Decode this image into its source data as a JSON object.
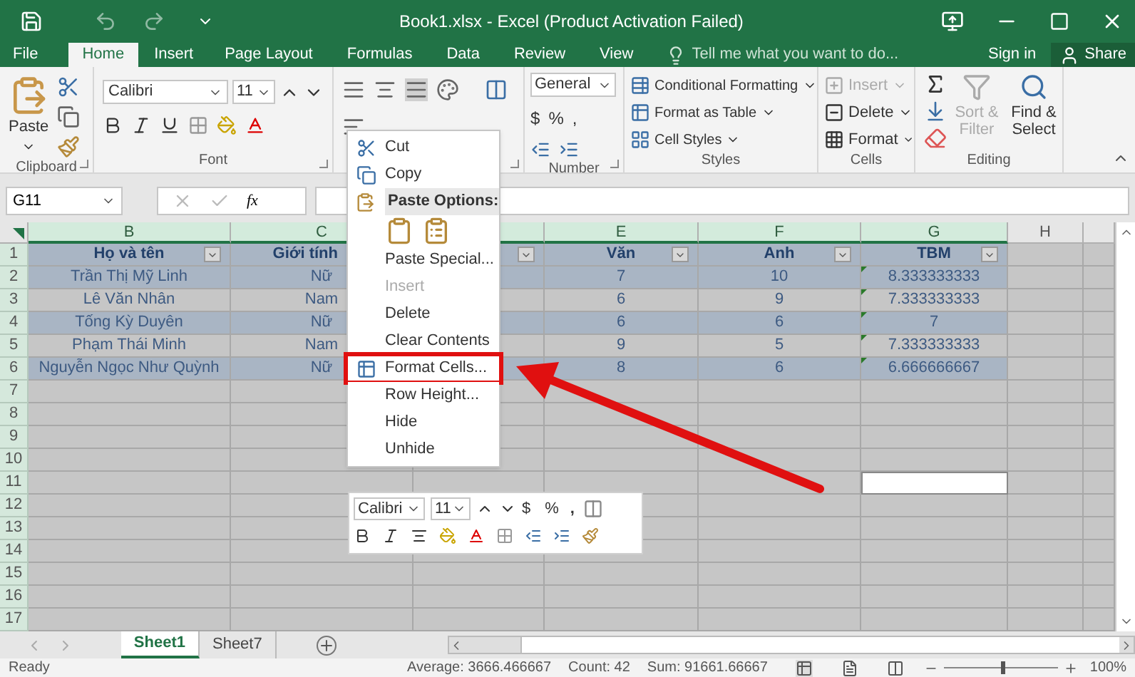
{
  "window": {
    "title": "Book1.xlsx - Excel (Product Activation Failed)"
  },
  "ribbon_tabs": [
    {
      "label": "File",
      "selected": false
    },
    {
      "label": "Home",
      "selected": true
    },
    {
      "label": "Insert",
      "selected": false
    },
    {
      "label": "Page Layout",
      "selected": false
    },
    {
      "label": "Formulas",
      "selected": false
    },
    {
      "label": "Data",
      "selected": false
    },
    {
      "label": "Review",
      "selected": false
    },
    {
      "label": "View",
      "selected": false
    }
  ],
  "tell_me": "Tell me what you want to do...",
  "sign_in": "Sign in",
  "share": "Share",
  "clipboard": {
    "paste": "Paste",
    "label": "Clipboard"
  },
  "font": {
    "name": "Calibri",
    "size": "11",
    "label": "Font"
  },
  "number": {
    "format": "General",
    "currency": "$",
    "percent": "%",
    "comma": ",",
    "label": "Number"
  },
  "styles": {
    "items": [
      "Conditional Formatting",
      "Format as Table",
      "Cell Styles"
    ],
    "label": "Styles"
  },
  "cells": {
    "items": [
      {
        "label": "Insert",
        "disabled": true
      },
      {
        "label": "Delete",
        "disabled": false
      },
      {
        "label": "Format",
        "disabled": false
      }
    ],
    "label": "Cells"
  },
  "editing": {
    "sort": {
      "label": "Sort & Filter",
      "disabled": true
    },
    "find": {
      "label": "Find & Select",
      "disabled": false
    },
    "label": "Editing"
  },
  "formula_bar": {
    "name_box": "G11",
    "fx": "fx"
  },
  "columns": [
    {
      "letter": "B",
      "selected": true
    },
    {
      "letter": "C",
      "selected": true
    },
    {
      "selected": true
    },
    {
      "letter": "E",
      "selected": true
    },
    {
      "letter": "F",
      "selected": true
    },
    {
      "letter": "G",
      "selected": true
    },
    {
      "letter": "H",
      "selected": false
    },
    {
      "selected": false
    }
  ],
  "table_header": {
    "number": "1",
    "cells": [
      "Họ và tên",
      "Giới tính",
      "Văn",
      "Anh",
      "TBM"
    ]
  },
  "table_rows": [
    {
      "number": "2",
      "cells": [
        "Trần Thị Mỹ Linh",
        "Nữ",
        "7",
        "10",
        "8.333333333"
      ]
    },
    {
      "number": "3",
      "cells": [
        "Lê Văn Nhân",
        "Nam",
        "6",
        "9",
        "7.333333333"
      ]
    },
    {
      "number": "4",
      "cells": [
        "Tống Kỳ Duyên",
        "Nữ",
        "6",
        "6",
        "7"
      ]
    },
    {
      "number": "5",
      "cells": [
        "Phạm Thái Minh",
        "Nam",
        "9",
        "5",
        "7.333333333"
      ]
    },
    {
      "number": "6",
      "cells": [
        "Nguyễn Ngọc Như Quỳnh",
        "Nữ",
        "8",
        "6",
        "6.666666667"
      ]
    }
  ],
  "empty_rows": [
    "7",
    "8",
    "9",
    "10",
    "11",
    "12",
    "13",
    "14",
    "15",
    "16",
    "17"
  ],
  "context_menu": [
    {
      "kind": "icon_item",
      "label": "Cut",
      "disabled": false,
      "highlighted": false
    },
    {
      "kind": "icon_item",
      "label": "Copy",
      "disabled": false,
      "highlighted": false
    },
    {
      "kind": "header",
      "label": "Paste Options:"
    },
    {
      "kind": "paste_icons"
    },
    {
      "kind": "item",
      "label": "Paste Special...",
      "disabled": false,
      "highlighted": false
    },
    {
      "kind": "item",
      "label": "Insert",
      "disabled": true,
      "highlighted": false
    },
    {
      "kind": "item",
      "label": "Delete",
      "disabled": false,
      "highlighted": false
    },
    {
      "kind": "item",
      "label": "Clear Contents",
      "disabled": false,
      "highlighted": false
    },
    {
      "kind": "icon_item",
      "label": "Format Cells...",
      "disabled": false,
      "highlighted": true
    },
    {
      "kind": "item",
      "label": "Row Height...",
      "disabled": false,
      "highlighted": false
    },
    {
      "kind": "item",
      "label": "Hide",
      "disabled": false,
      "highlighted": false
    },
    {
      "kind": "item",
      "label": "Unhide",
      "disabled": false,
      "highlighted": false
    }
  ],
  "mini_toolbar": {
    "font": "Calibri",
    "size": "11",
    "currency": "$",
    "percent": "%",
    "comma": ","
  },
  "sheet_tabs": [
    {
      "label": "Sheet1",
      "selected": true
    },
    {
      "label": "Sheet7",
      "selected": false
    }
  ],
  "status_bar": {
    "ready": "Ready",
    "average": "Average: 3666.466667",
    "count": "Count: 42",
    "sum": "Sum: 91661.66667",
    "zoom": "100%",
    "zoom_level": {
      "level": 0.5
    }
  }
}
